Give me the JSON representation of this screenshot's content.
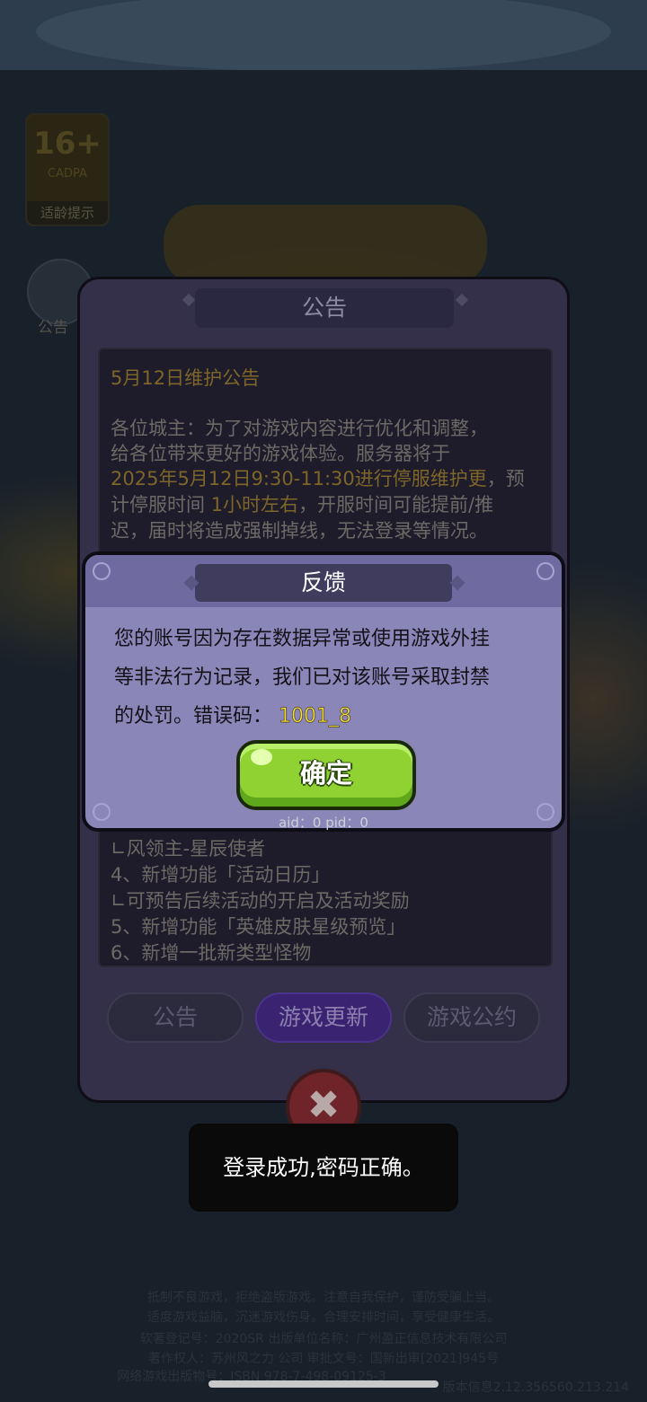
{
  "age_badge": {
    "rating": "16+",
    "system": "CADPA",
    "tip": "适龄提示"
  },
  "side_notice": {
    "label": "公告"
  },
  "notice_panel": {
    "title": "公告",
    "content_title": "5月12日维护公告",
    "paragraph": [
      {
        "text": "各位城主：为了对游戏内容进行优化和调整，",
        "hl": false
      },
      {
        "text": "给各位带来更好的游戏体验。服务器将于",
        "hl": false
      }
    ],
    "line3_hl": "2025年5月12日9:30-11:30进行停服维护更",
    "line3_rest": "，预",
    "line4_a": "计停服时间",
    "line4_hl": "1小时左右",
    "line4_b": "，开服时间可能提前/推",
    "line5": "迟，届时将造成强制掉线，无法登录等情况。",
    "lower_lines": [
      "∟风领主-星辰使者",
      "4、新增功能「活动日历」",
      "∟可预告后续活动的开启及活动奖励",
      "5、新增功能「英雄皮肤星级预览」",
      "6、新增一批新类型怪物"
    ],
    "tabs": [
      "公告",
      "游戏更新",
      "游戏公约"
    ],
    "active_tab": 1
  },
  "dialog": {
    "title": "反馈",
    "message_line1": "您的账号因为存在数据异常或使用游戏外挂",
    "message_line2": "等非法行为记录，我们已对该账号采取封禁",
    "message_line3": "的处罚。错误码：",
    "error_code": "1001_8",
    "ok_label": "确定"
  },
  "ids_text": "aid：0 pid：0",
  "toast": "登录成功,密码正确。",
  "footer": {
    "line1": "抵制不良游戏，拒绝盗版游戏。注意自我保护，谨防受骗上当。",
    "line2": "适度游戏益脑，沉迷游戏伤身。合理安排时间，享受健康生活。",
    "line3": "软著登记号：2020SR   出版单位名称：广州盈正信息技术有限公司",
    "line4": "著作权人：苏州风之力  公司 审批文号：国新出审[2021]945号",
    "line5": "网络游戏出版物号：ISBN 978-7-498-09125-3",
    "version": "版本信息2.12.356560.213.214"
  },
  "colors": {
    "dialog_bg": "#8b86b8",
    "ok_button": "#8fd232",
    "error_code": "#f6e23c",
    "toast_bg": "#0a0a0a"
  }
}
